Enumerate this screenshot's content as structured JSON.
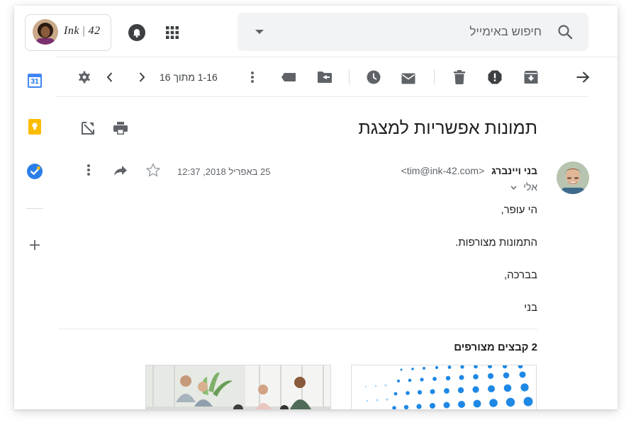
{
  "header": {
    "brand": "Ink",
    "brand_number": "42",
    "search_placeholder": "חיפוש באימייל"
  },
  "toolbar": {
    "page_count": "1-16 מתוך 16"
  },
  "left_rail": {
    "calendar_day": "31"
  },
  "message": {
    "subject": "תמונות אפשריות למצגת",
    "sender_name": "בני ויינברג",
    "sender_email": "<tim@ink-42.com>",
    "recipient": "אלי",
    "date": "25 באפריל 2018, 12:37",
    "body": [
      "הי עופר,",
      "התמונות מצורפות.",
      "בברכה,",
      "בני"
    ]
  },
  "attachments": {
    "title": "2 קבצים מצורפים"
  },
  "colors": {
    "icon_gray": "#5f6368",
    "icon_dark": "#3c4043",
    "calendar_blue": "#4285f4",
    "keep_yellow": "#fbbc04",
    "tasks_blue": "#2b7de9",
    "search_bg": "#f1f3f4",
    "dots_blue": "#1e88e5"
  }
}
